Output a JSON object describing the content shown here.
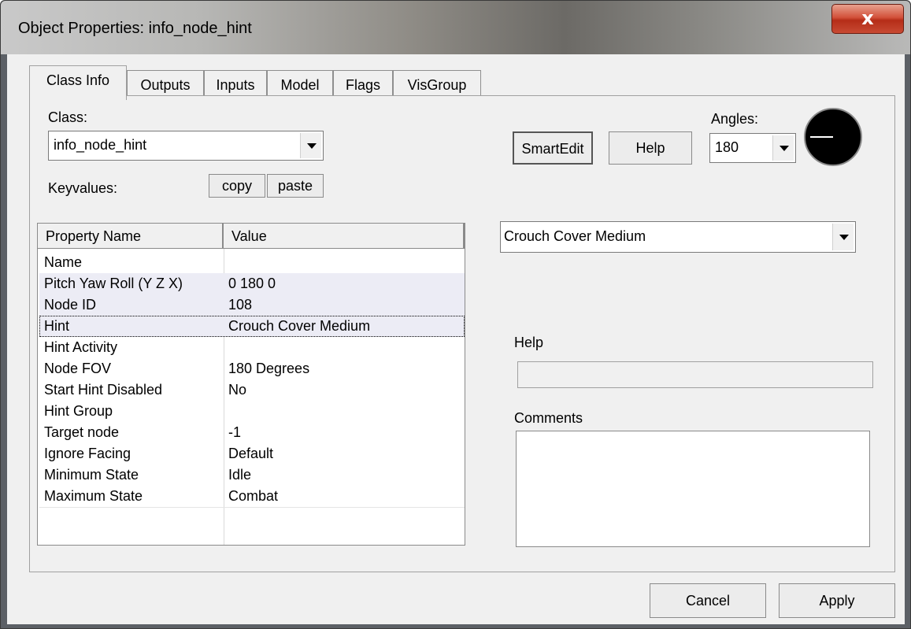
{
  "window": {
    "title": "Object Properties: info_node_hint",
    "close_glyph": "x"
  },
  "tabs": [
    {
      "label": "Class Info",
      "active": true
    },
    {
      "label": "Outputs"
    },
    {
      "label": "Inputs"
    },
    {
      "label": "Model"
    },
    {
      "label": "Flags"
    },
    {
      "label": "VisGroup"
    }
  ],
  "class_section": {
    "class_label": "Class:",
    "class_value": "info_node_hint",
    "keyvalues_label": "Keyvalues:",
    "copy_label": "copy",
    "paste_label": "paste"
  },
  "toolbar": {
    "smartedit_label": "SmartEdit",
    "help_label": "Help",
    "angles_label": "Angles:",
    "angles_value": "180"
  },
  "grid": {
    "columns": [
      "Property Name",
      "Value"
    ],
    "rows": [
      {
        "name": "Name",
        "value": ""
      },
      {
        "name": "Pitch Yaw Roll (Y Z X)",
        "value": "0 180 0"
      },
      {
        "name": "Node ID",
        "value": "108"
      },
      {
        "name": "Hint",
        "value": "Crouch Cover Medium"
      },
      {
        "name": "Hint Activity",
        "value": ""
      },
      {
        "name": "Node FOV",
        "value": "180 Degrees"
      },
      {
        "name": "Start Hint Disabled",
        "value": "No"
      },
      {
        "name": "Hint Group",
        "value": ""
      },
      {
        "name": "Target node",
        "value": "-1"
      },
      {
        "name": "Ignore Facing",
        "value": "Default"
      },
      {
        "name": "Minimum State",
        "value": "Idle"
      },
      {
        "name": "Maximum State",
        "value": "Combat"
      }
    ]
  },
  "value_editor": {
    "selected": "Crouch Cover Medium"
  },
  "help_section": {
    "label": "Help",
    "text": ""
  },
  "comments_section": {
    "label": "Comments",
    "text": ""
  },
  "footer": {
    "cancel_label": "Cancel",
    "apply_label": "Apply"
  }
}
